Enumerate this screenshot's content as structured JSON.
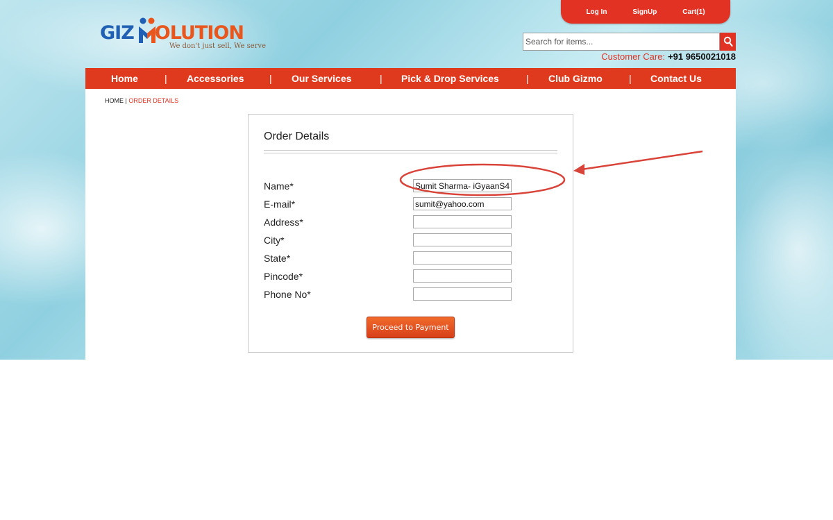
{
  "logo": {
    "part1": "GIZ",
    "part2": "OLUTION",
    "tagline": "We don't just sell, We serve"
  },
  "top_links": {
    "login": "Log In",
    "signup": "SignUp",
    "cart": "Cart(1)"
  },
  "search": {
    "placeholder": "Search for items...",
    "icon": "search-icon"
  },
  "customer_care": {
    "label": "Customer Care:",
    "number": "+91 9650021018"
  },
  "nav": {
    "items": [
      "Home",
      "Accessories",
      "Our Services",
      "Pick & Drop Services",
      "Club Gizmo",
      "Contact Us"
    ],
    "separator": "|"
  },
  "breadcrumb": {
    "home": "HOME",
    "separator": " | ",
    "current": "ORDER DETAILS"
  },
  "form": {
    "title": "Order Details",
    "fields": [
      {
        "label": "Name*",
        "value": "Sumit Sharma- iGyaanS4"
      },
      {
        "label": "E-mail*",
        "value": "sumit@yahoo.com"
      },
      {
        "label": "Address*",
        "value": ""
      },
      {
        "label": "City*",
        "value": ""
      },
      {
        "label": "State*",
        "value": ""
      },
      {
        "label": "Pincode*",
        "value": ""
      },
      {
        "label": "Phone No*",
        "value": ""
      }
    ],
    "submit_label": "Proceed to Payment"
  },
  "colors": {
    "brand_red": "#e23224",
    "nav_red": "#e03a1e",
    "logo_blue": "#1f5fb4",
    "logo_orange": "#e9561d",
    "annotation": "#d9443a"
  }
}
